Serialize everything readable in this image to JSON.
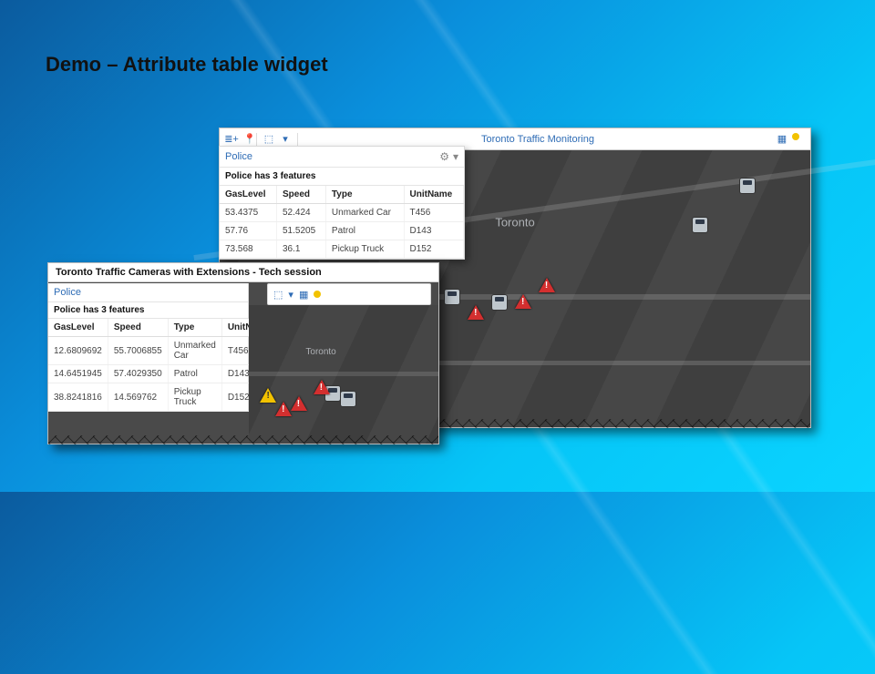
{
  "slide": {
    "title": "Demo – Attribute table widget"
  },
  "mapWindow": {
    "appTitle": "Toronto Traffic Monitoring",
    "cityLabel": "Toronto",
    "cityLabelSmall": "Toronto"
  },
  "attrPanel": {
    "layerName": "Police",
    "featureSummary": "Police has 3 features",
    "columns": {
      "c0": "GasLevel",
      "c1": "Speed",
      "c2": "Type",
      "c3": "UnitName"
    },
    "rows": [
      {
        "gas": "53.4375",
        "speed": "52.424",
        "type": "Unmarked Car",
        "unit": "T456"
      },
      {
        "gas": "57.76",
        "speed": "51.5205",
        "type": "Patrol",
        "unit": "D143"
      },
      {
        "gas": "73.568",
        "speed": "36.1",
        "type": "Pickup Truck",
        "unit": "D152"
      }
    ]
  },
  "variant": {
    "windowTitle": "Toronto Traffic Cameras with Extensions - Tech session",
    "layerName": "Police",
    "featureSummary": "Police has 3 features",
    "columns": {
      "c0": "GasLevel",
      "c1": "Speed",
      "c2": "Type",
      "c3": "UnitName"
    },
    "rows": [
      {
        "gas": "12.6809692",
        "speed": "55.7006855",
        "type": "Unmarked Car",
        "unit": "T456"
      },
      {
        "gas": "14.6451945",
        "speed": "57.4029350",
        "type": "Patrol",
        "unit": "D143"
      },
      {
        "gas": "38.8241816",
        "speed": "14.569762",
        "type": "Pickup Truck",
        "unit": "D152"
      }
    ],
    "cityLabel": "Toronto"
  },
  "icons": {
    "gear": "⚙",
    "pin": "📍",
    "layers": "▦",
    "dropdown": "▾",
    "select": "⬚",
    "listPlus": "≣+"
  }
}
